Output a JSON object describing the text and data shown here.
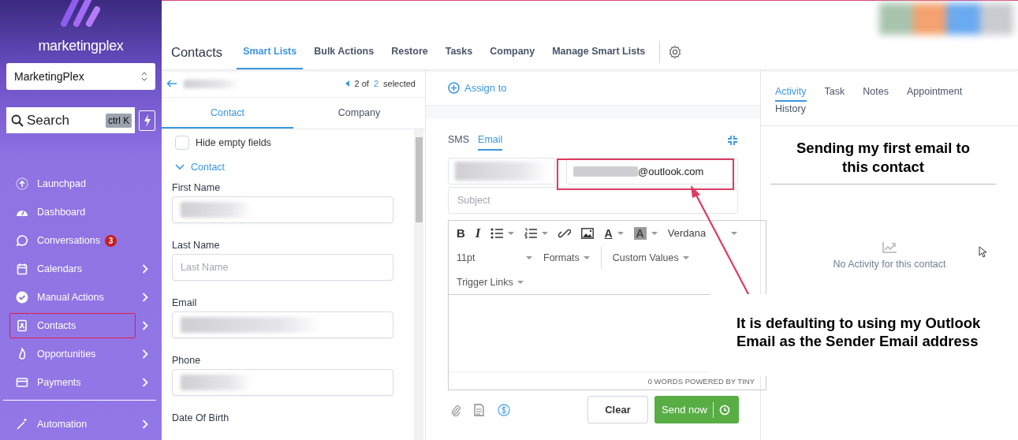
{
  "sidebar": {
    "logo": "marketingplex",
    "account": "MarketingPlex",
    "search": {
      "placeholder": "Search",
      "shortcut": "ctrl K"
    },
    "nav": [
      {
        "kind": "launchpad",
        "label": "Launchpad",
        "chevron": false,
        "highlighted": false
      },
      {
        "kind": "dashboard",
        "label": "Dashboard",
        "chevron": false,
        "highlighted": false
      },
      {
        "kind": "conversations",
        "label": "Conversations",
        "badge": "3",
        "chevron": false,
        "highlighted": false
      },
      {
        "kind": "calendars",
        "label": "Calendars",
        "chevron": true,
        "highlighted": false
      },
      {
        "kind": "manual_actions",
        "label": "Manual Actions",
        "chevron": true,
        "highlighted": false
      },
      {
        "kind": "contacts",
        "label": "Contacts",
        "chevron": true,
        "highlighted": true
      },
      {
        "kind": "opportunities",
        "label": "Opportunities",
        "chevron": true,
        "highlighted": false
      },
      {
        "kind": "payments",
        "label": "Payments",
        "chevron": true,
        "highlighted": false
      },
      {
        "kind": "automation",
        "label": "Automation",
        "chevron": true,
        "highlighted": false
      }
    ]
  },
  "header": {
    "title": "Contacts",
    "tabs": [
      {
        "label": "Smart Lists",
        "selected": true
      },
      {
        "label": "Bulk Actions",
        "selected": false
      },
      {
        "label": "Restore",
        "selected": false
      },
      {
        "label": "Tasks",
        "selected": false
      },
      {
        "label": "Company",
        "selected": false
      },
      {
        "label": "Manage Smart Lists",
        "selected": false
      }
    ]
  },
  "contact_panel": {
    "record_position": "2 of",
    "record_total": "2",
    "record_suffix": "selected",
    "tabs": [
      {
        "label": "Contact",
        "selected": true
      },
      {
        "label": "Company",
        "selected": false
      }
    ],
    "hide_empty": {
      "label": "Hide empty fields",
      "checked": false
    },
    "section": "Contact",
    "fields": [
      {
        "label": "First Name",
        "kind": "redacted"
      },
      {
        "label": "Last Name",
        "kind": "empty",
        "placeholder": "Last Name"
      },
      {
        "label": "Email",
        "kind": "redacted"
      },
      {
        "label": "Phone",
        "kind": "redacted"
      },
      {
        "label": "Date Of Birth",
        "kind": "hidden"
      }
    ]
  },
  "composer": {
    "assign": "Assign to",
    "channels": [
      {
        "label": "SMS",
        "selected": false
      },
      {
        "label": "Email",
        "selected": true
      }
    ],
    "from_domain": "@outlook.com",
    "subject_placeholder": "Subject",
    "toolbar": [
      {
        "kind": "bold",
        "label": "B",
        "dropdown": false
      },
      {
        "kind": "italic",
        "label": "I",
        "dropdown": false
      },
      {
        "kind": "bullets",
        "dropdown": true
      },
      {
        "kind": "numbers",
        "dropdown": true
      },
      {
        "kind": "link",
        "dropdown": false
      },
      {
        "kind": "image",
        "dropdown": false
      },
      {
        "kind": "text_color",
        "label": "A",
        "dropdown": true
      },
      {
        "kind": "highlight",
        "label": "A",
        "dropdown": true
      },
      {
        "kind": "font",
        "label": "Verdana",
        "dropdown": true
      }
    ],
    "format_menus": [
      {
        "label": "11pt"
      },
      {
        "label": "Formats"
      },
      {
        "label": "Custom Values"
      }
    ],
    "link_menus": [
      {
        "label": "Trigger Links"
      }
    ],
    "footer": "0 WORDS POWERED BY TINY",
    "clear": "Clear",
    "send": "Send now"
  },
  "activity_panel": {
    "tabs": [
      {
        "label": "Activity",
        "selected": true
      },
      {
        "label": "Task",
        "selected": false
      },
      {
        "label": "Notes",
        "selected": false
      },
      {
        "label": "Appointment",
        "selected": false
      },
      {
        "label": "History",
        "selected": false
      }
    ],
    "empty_text": "No Activity for this contact"
  },
  "annotations": [
    {
      "kind": "heading",
      "text": "Sending my first email to this contact"
    },
    {
      "kind": "callout",
      "text": "It is defaulting to using my Outlook Email as the Sender Email address"
    }
  ]
}
